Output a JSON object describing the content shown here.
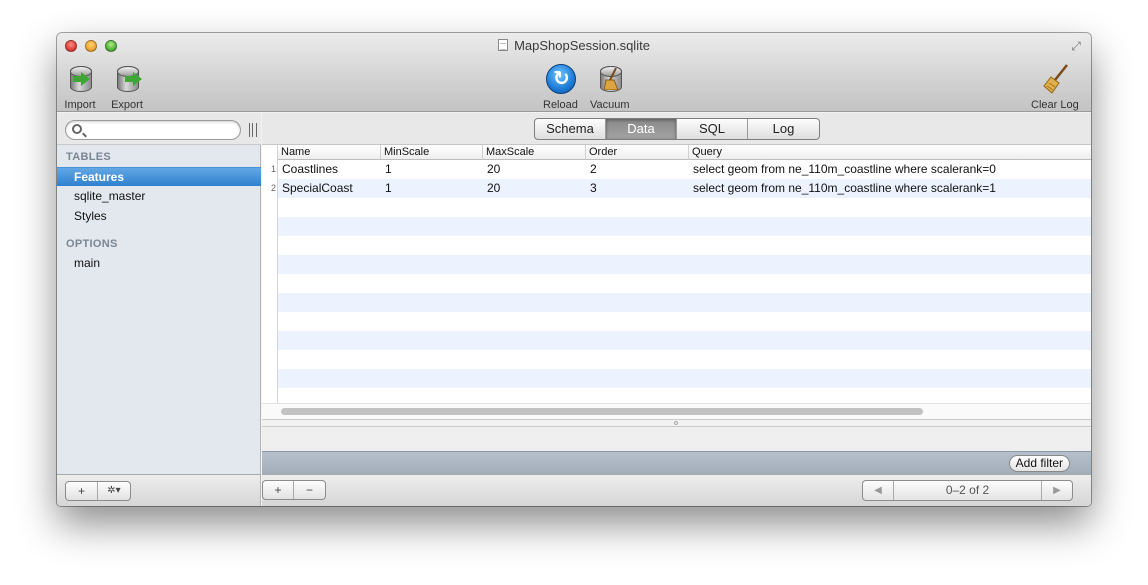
{
  "window": {
    "title": "MapShopSession.sqlite"
  },
  "toolbar": {
    "import_label": "Import",
    "export_label": "Export",
    "reload_label": "Reload",
    "vacuum_label": "Vacuum",
    "clear_log_label": "Clear Log"
  },
  "sidebar": {
    "search_placeholder": "",
    "tables_heading": "TABLES",
    "tables": [
      {
        "label": "Features",
        "selected": true
      },
      {
        "label": "sqlite_master",
        "selected": false
      },
      {
        "label": "Styles",
        "selected": false
      }
    ],
    "options_heading": "OPTIONS",
    "options": [
      {
        "label": "main"
      }
    ],
    "add_symbol": "+",
    "gear_symbol": "✲▾"
  },
  "tabs": [
    {
      "label": "Schema",
      "active": false
    },
    {
      "label": "Data",
      "active": true
    },
    {
      "label": "SQL",
      "active": false
    },
    {
      "label": "Log",
      "active": false
    }
  ],
  "grid": {
    "columns": [
      "Name",
      "MinScale",
      "MaxScale",
      "Order",
      "Query"
    ],
    "rows": [
      {
        "num": "1",
        "cells": [
          "Coastlines",
          "1",
          "20",
          "2",
          "select geom from ne_110m_coastline where scalerank=0"
        ]
      },
      {
        "num": "2",
        "cells": [
          "SpecialCoast",
          "1",
          "20",
          "3",
          "select geom from ne_110m_coastline where scalerank=1"
        ]
      }
    ]
  },
  "filter": {
    "add_filter_label": "Add filter"
  },
  "bottom": {
    "add_symbol": "+",
    "remove_symbol": "−",
    "prev_symbol": "◀",
    "next_symbol": "▶",
    "page_status": "0–2 of 2"
  },
  "colors": {
    "selection": "#3a87d4",
    "stripe": "#edf3fe",
    "filter_bar": "#aab4c1"
  },
  "icons": {
    "import": "database-import-icon",
    "export": "database-export-icon",
    "reload": "reload-icon",
    "vacuum": "vacuum-icon",
    "clear_log": "broom-icon"
  }
}
